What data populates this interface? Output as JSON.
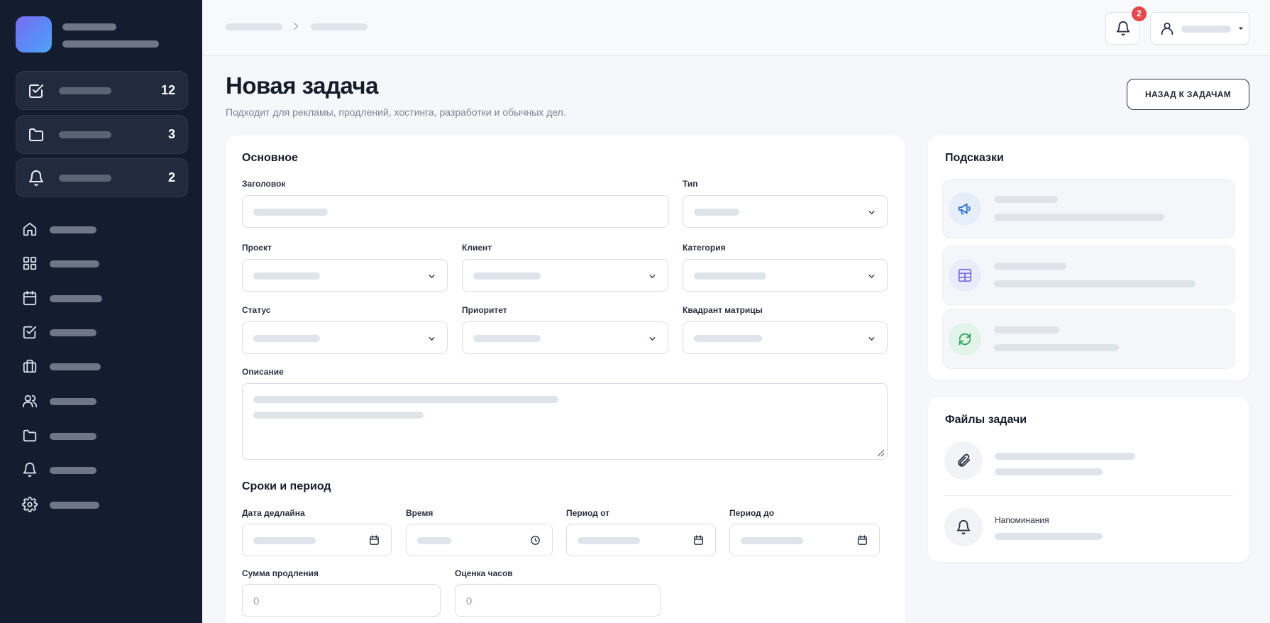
{
  "sidebar": {
    "stats": [
      {
        "icon": "checkbox-icon",
        "count": "12"
      },
      {
        "icon": "folder-icon",
        "count": "3"
      },
      {
        "icon": "bell-icon",
        "count": "2"
      }
    ],
    "nav": [
      {
        "icon": "home-icon"
      },
      {
        "icon": "grid-icon"
      },
      {
        "icon": "calendar-icon"
      },
      {
        "icon": "checkbox-icon"
      },
      {
        "icon": "briefcase-icon"
      },
      {
        "icon": "users-icon"
      },
      {
        "icon": "folder-icon"
      },
      {
        "icon": "bell-icon"
      },
      {
        "icon": "gear-icon"
      }
    ]
  },
  "topbar": {
    "notifications_count": "2"
  },
  "header": {
    "title": "Новая задача",
    "subtitle": "Подходит для рекламы, продлений, хостинга, разработки и обычных дел.",
    "back_button": "НАЗАД К ЗАДАЧАМ"
  },
  "form": {
    "section_main": "Основное",
    "labels": {
      "title": "Заголовок",
      "type": "Тип",
      "project": "Проект",
      "client": "Клиент",
      "category": "Категория",
      "status": "Статус",
      "priority": "Приоритет",
      "quadrant": "Квадрант матрицы",
      "description": "Описание"
    },
    "section_dates": "Сроки и период",
    "date_labels": {
      "deadline": "Дата дедлайна",
      "time": "Время",
      "period_from": "Период от",
      "period_to": "Период до"
    },
    "amount_label": "Сумма продления",
    "amount_placeholder": "0",
    "hours_label": "Оценка часов",
    "hours_placeholder": "0"
  },
  "hints": {
    "title": "Подсказки",
    "items": [
      {
        "icon": "megaphone-icon",
        "color": "#2f6fd6"
      },
      {
        "icon": "table-icon",
        "color": "#7c6fe0"
      },
      {
        "icon": "refresh-icon",
        "color": "#2aa35b"
      }
    ]
  },
  "files": {
    "title": "Файлы задачи",
    "reminders_label": "Напоминания"
  },
  "colors": {
    "sidebar_bg": "#141d2f",
    "accent": "#5a8cf6",
    "badge": "#e5484d"
  }
}
